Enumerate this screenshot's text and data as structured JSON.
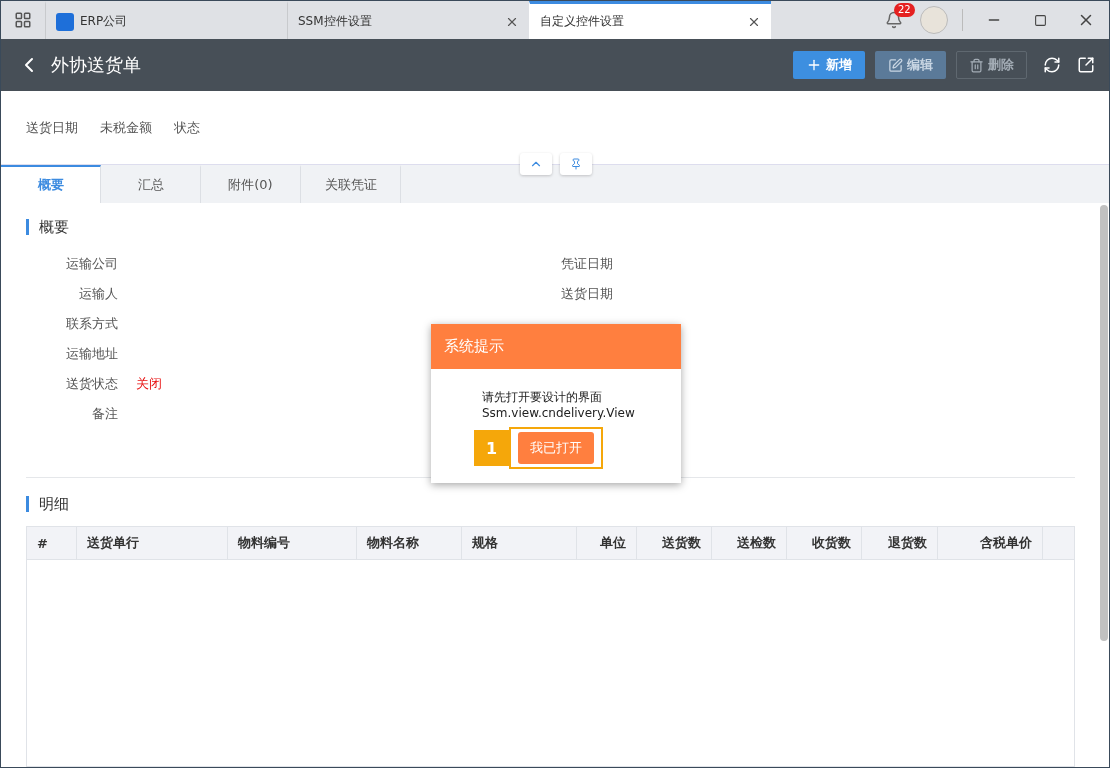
{
  "titlebar": {
    "tabs": [
      {
        "label": "ERP公司",
        "selected": false,
        "kind": "home"
      },
      {
        "label": "SSM控件设置",
        "selected": false,
        "kind": "page"
      },
      {
        "label": "自定义控件设置",
        "selected": true,
        "kind": "page"
      }
    ],
    "notification_badge": "22"
  },
  "header": {
    "title": "外协送货单",
    "buttons": [
      {
        "label": "新增",
        "kind": "add",
        "disabled": false
      },
      {
        "label": "编辑",
        "kind": "edit",
        "disabled": true
      },
      {
        "label": "删除",
        "kind": "delete",
        "disabled": true
      }
    ]
  },
  "summary_fields": [
    "送货日期",
    "未税金额",
    "状态"
  ],
  "tabs": [
    {
      "label": "概要",
      "selected": true
    },
    {
      "label": "汇总",
      "selected": false
    },
    {
      "label": "附件(0)",
      "selected": false
    },
    {
      "label": "关联凭证",
      "selected": false
    }
  ],
  "overview": {
    "title": "概要",
    "left_fields": [
      {
        "label": "运输公司"
      },
      {
        "label": "运输人"
      },
      {
        "label": "联系方式"
      },
      {
        "label": "运输地址"
      },
      {
        "label": "送货状态",
        "value": "关闭"
      },
      {
        "label": "备注"
      }
    ],
    "right_fields": [
      {
        "label": "凭证日期"
      },
      {
        "label": "送货日期"
      }
    ]
  },
  "detail": {
    "title": "明细",
    "columns": [
      {
        "label": "#",
        "kind": "text"
      },
      {
        "label": "送货单行",
        "kind": "text"
      },
      {
        "label": "物料编号",
        "kind": "text"
      },
      {
        "label": "物料名称",
        "kind": "text"
      },
      {
        "label": "规格",
        "kind": "text"
      },
      {
        "label": "单位",
        "kind": "number"
      },
      {
        "label": "送货数",
        "kind": "number"
      },
      {
        "label": "送检数",
        "kind": "number"
      },
      {
        "label": "收货数",
        "kind": "number"
      },
      {
        "label": "退货数",
        "kind": "number"
      },
      {
        "label": "含税单价",
        "kind": "number"
      }
    ]
  },
  "dialog": {
    "title": "系统提示",
    "message": [
      "请先打开要设计的界面",
      "Ssm.view.cndelivery.View"
    ],
    "step": "1",
    "button": "我已打开"
  }
}
